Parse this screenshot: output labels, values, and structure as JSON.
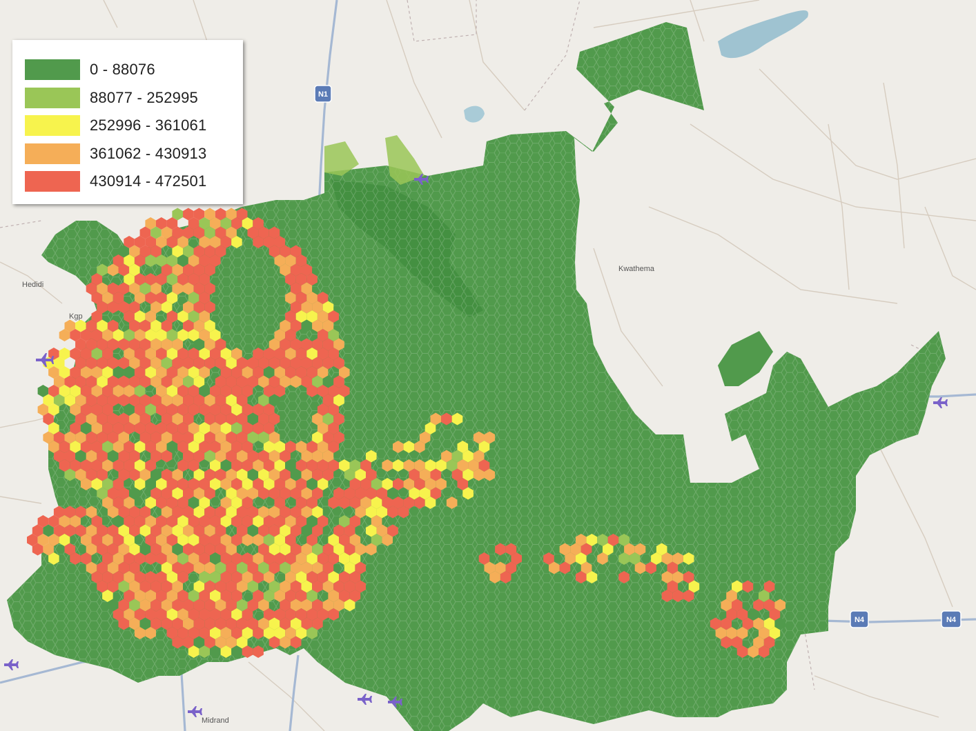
{
  "legend": {
    "classes": [
      {
        "label": "0 - 88076",
        "color": "#519a4c"
      },
      {
        "label": "88077 - 252995",
        "color": "#9ac657"
      },
      {
        "label": "252996 - 361061",
        "color": "#f7f34d"
      },
      {
        "label": "361062 - 430913",
        "color": "#f5ae58"
      },
      {
        "label": "430914 - 472501",
        "color": "#ee6551"
      }
    ]
  },
  "places": [
    {
      "name": "Midrand"
    },
    {
      "name": "Kwathema"
    },
    {
      "name": "Hedidi"
    },
    {
      "name": "Kgp"
    }
  ],
  "road_shields": [
    "N1",
    "N4",
    "N4"
  ],
  "colors": {
    "background": "#efede8",
    "road_major": "#9fb3cf",
    "road_minor": "#d9cfc3",
    "water": "#9fc3d1",
    "boundary": "#b9a8a8"
  }
}
